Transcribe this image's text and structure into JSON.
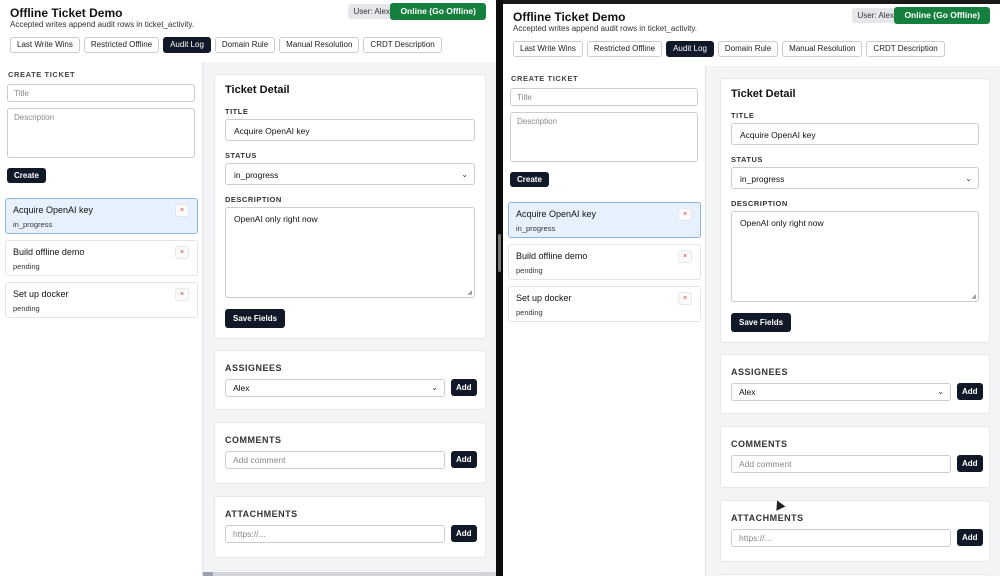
{
  "app": {
    "title": "Offline Ticket Demo",
    "subtitle": "Accepted writes append audit rows in ticket_activity.",
    "user_label": "User: Alex",
    "online_button": "Online (Go Offline)"
  },
  "tabs": [
    {
      "label": "Last Write Wins",
      "active": false
    },
    {
      "label": "Restricted Offline",
      "active": false
    },
    {
      "label": "Audit Log",
      "active": true
    },
    {
      "label": "Domain Rule",
      "active": false
    },
    {
      "label": "Manual Resolution",
      "active": false
    },
    {
      "label": "CRDT Description",
      "active": false
    }
  ],
  "create": {
    "section_label": "CREATE TICKET",
    "title_placeholder": "Title",
    "description_placeholder": "Description",
    "button": "Create"
  },
  "tickets": [
    {
      "title": "Acquire OpenAI key",
      "status": "in_progress",
      "selected": true
    },
    {
      "title": "Build offline demo",
      "status": "pending",
      "selected": false
    },
    {
      "title": "Set up docker",
      "status": "pending",
      "selected": false
    }
  ],
  "delete_glyph": "×",
  "detail": {
    "heading": "Ticket Detail",
    "title_label": "TITLE",
    "title_value": "Acquire OpenAI key",
    "status_label": "STATUS",
    "status_value": "in_progress",
    "description_label": "DESCRIPTION",
    "description_value": "OpenAI only right now",
    "save_button": "Save Fields"
  },
  "assignees": {
    "heading": "ASSIGNEES",
    "selected": "Alex",
    "add_button": "Add"
  },
  "comments": {
    "heading": "COMMENTS",
    "placeholder": "Add comment",
    "add_button": "Add"
  },
  "attachments": {
    "heading": "ATTACHMENTS",
    "placeholder": "https://...",
    "add_button": "Add"
  },
  "icons": {
    "chevron": "chevron-down-icon",
    "delete": "close-icon",
    "cursor": "mouse-pointer-icon"
  },
  "colors": {
    "online_green": "#15803d",
    "dark_button": "#111827",
    "selected_ticket_bg": "#e7f0fd",
    "delete_red": "#c0392b"
  }
}
